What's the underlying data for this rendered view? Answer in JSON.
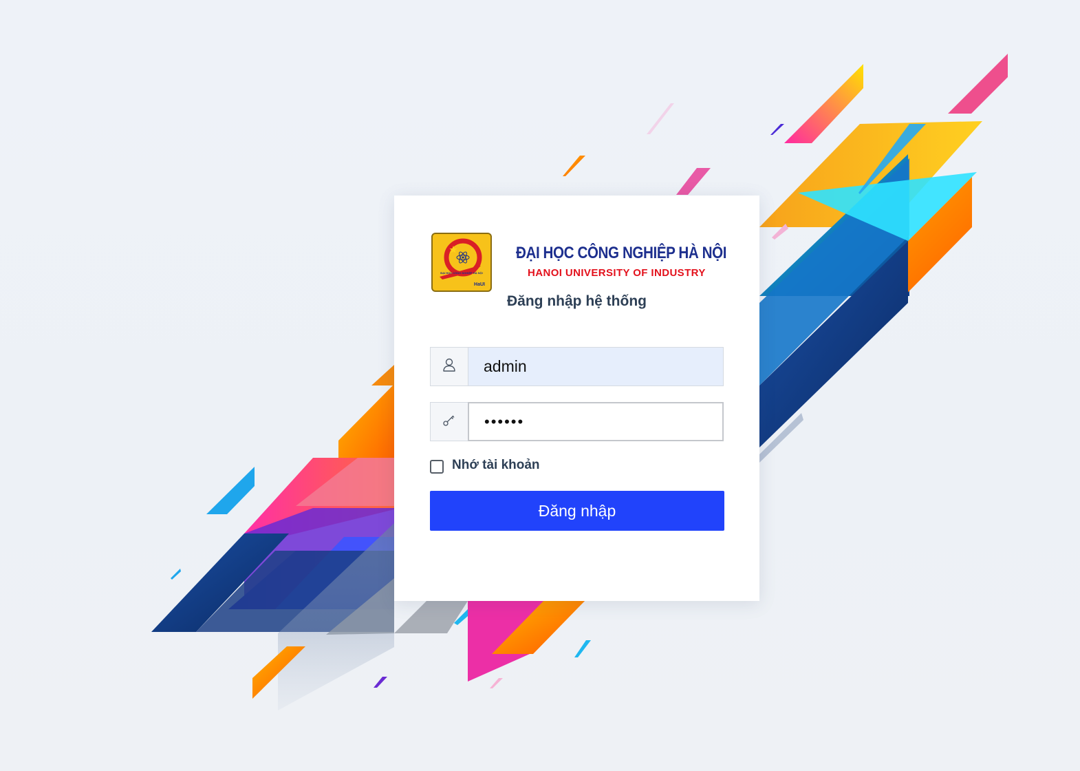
{
  "university": {
    "name_vi": "ĐẠI HỌC CÔNG NGHIỆP HÀ NỘI",
    "name_en": "HANOI UNIVERSITY OF INDUSTRY",
    "logo_caption": "ĐẠI HỌC CÔNG NGHIỆP HÀ NỘI",
    "logo_brand": "HaUI"
  },
  "form": {
    "title": "Đăng nhập hệ thống",
    "username": {
      "value": "admin",
      "icon": "user-icon"
    },
    "password": {
      "value": "••••••",
      "icon": "key-icon"
    },
    "remember_label": "Nhớ tài khoản",
    "remember_checked": false,
    "submit_label": "Đăng nhập"
  },
  "colors": {
    "primary_button": "#2143fb",
    "title_text": "#2d3f55",
    "university_blue": "#1d2f8e",
    "university_red": "#e3111c",
    "username_field_bg": "#e6eefc"
  }
}
